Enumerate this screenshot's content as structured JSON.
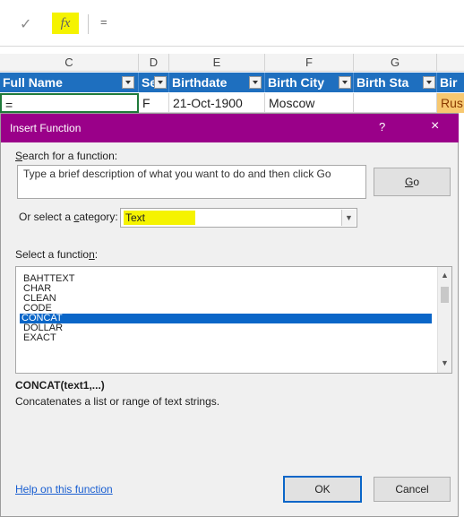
{
  "formula_bar": {
    "enter_icon": "checkmark-icon",
    "fx_label": "fx",
    "formula": "="
  },
  "columns": [
    "C",
    "D",
    "E",
    "F",
    "G"
  ],
  "table_headers": [
    "Full Name",
    "Se",
    "Birthdate",
    "Birth City",
    "Birth Sta",
    "Bir"
  ],
  "data_row": [
    "=",
    "F",
    "21-Oct-1900",
    "Moscow",
    "",
    "Rus"
  ],
  "dialog": {
    "title": "Insert Function",
    "help": "?",
    "close": "×",
    "search_label_prefix": "S",
    "search_label_rest": "earch for a function:",
    "search_text": "Type a brief description of what you want to do and then click Go",
    "go_prefix": "G",
    "go_rest": "o",
    "category_label_a": "Or select a ",
    "category_label_u": "c",
    "category_label_b": "ategory:",
    "category_value": "Text",
    "select_label_a": "Select a functio",
    "select_label_u": "n",
    "select_label_b": ":",
    "functions": [
      "BAHTTEXT",
      "CHAR",
      "CLEAN",
      "CODE",
      "CONCAT",
      "DOLLAR",
      "EXACT"
    ],
    "selected_function": "CONCAT",
    "signature": "CONCAT(text1,...)",
    "description": "Concatenates a list or range of text strings.",
    "help_link": "Help on this function",
    "ok": "OK",
    "cancel": "Cancel"
  },
  "colors": {
    "title_bar": "#9a0089",
    "table_header": "#1e6fbf",
    "selection": "#0a66c8",
    "highlight": "#f5f300"
  }
}
